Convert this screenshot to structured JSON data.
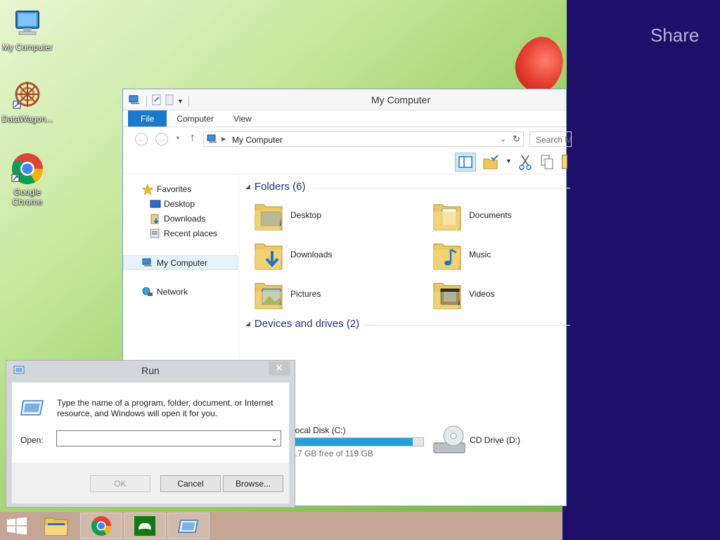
{
  "desktop": {
    "icons": [
      {
        "label": "My Computer",
        "icon": "computer-icon"
      },
      {
        "label": "DataWagon...",
        "icon": "datawagon-icon"
      },
      {
        "label": "Google Chrome",
        "icon": "chrome-icon"
      }
    ]
  },
  "share": {
    "title": "Share"
  },
  "explorer": {
    "title": "My Computer",
    "tabs": [
      "File",
      "Computer",
      "View"
    ],
    "address": "My Computer",
    "search_placeholder": "Search M",
    "nav": {
      "favorites": "Favorites",
      "desktop": "Desktop",
      "downloads": "Downloads",
      "recent": "Recent places",
      "mycomputer": "My Computer",
      "network": "Network"
    },
    "folders_header": "Folders (6)",
    "folders": [
      {
        "name": "Desktop"
      },
      {
        "name": "Documents"
      },
      {
        "name": "Downloads"
      },
      {
        "name": "Music"
      },
      {
        "name": "Pictures"
      },
      {
        "name": "Videos"
      }
    ],
    "devices_header": "Devices and drives (2)",
    "drives": {
      "local": {
        "name": "Local Disk (C:)",
        "free_text": "9.7 GB free of 119 GB",
        "used_fraction": 0.92
      },
      "cd": {
        "name": "CD Drive (D:)"
      }
    }
  },
  "run": {
    "title": "Run",
    "close": "✕",
    "description": "Type the name of a program, folder, document, or Internet resource, and Windows will open it for you.",
    "open_label": "Open:",
    "open_value": "",
    "ok": "OK",
    "cancel": "Cancel",
    "browse": "Browse..."
  },
  "taskbar": {
    "items": [
      "start-button",
      "file-explorer",
      "google-chrome",
      "store-app",
      "run-app"
    ]
  },
  "colors": {
    "share_bg": "#1e0f6b",
    "file_tab": "#1979ca",
    "taskbar": "#c4a694"
  }
}
